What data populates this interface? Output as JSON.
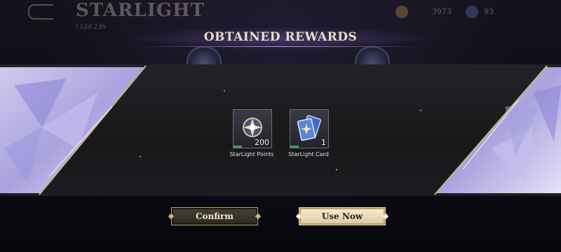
{
  "header": {
    "brand": "STARLIGHT",
    "brand_sub": "I  12d 23h",
    "resource_1": "3973",
    "resource_2": "93"
  },
  "dialog": {
    "title": "OBTAINED REWARDS",
    "rewards": [
      {
        "name": "StarLight Points",
        "count": "200",
        "icon": "starlight-points-icon"
      },
      {
        "name": "StarLight Card",
        "count": "1",
        "icon": "starlight-card-icon"
      }
    ],
    "confirm_label": "Confirm",
    "use_now_label": "Use Now"
  },
  "colors": {
    "accent_gold": "#b8a57c",
    "crystal": "#b9b3e6",
    "banner_bg": "#1c1b1f"
  }
}
